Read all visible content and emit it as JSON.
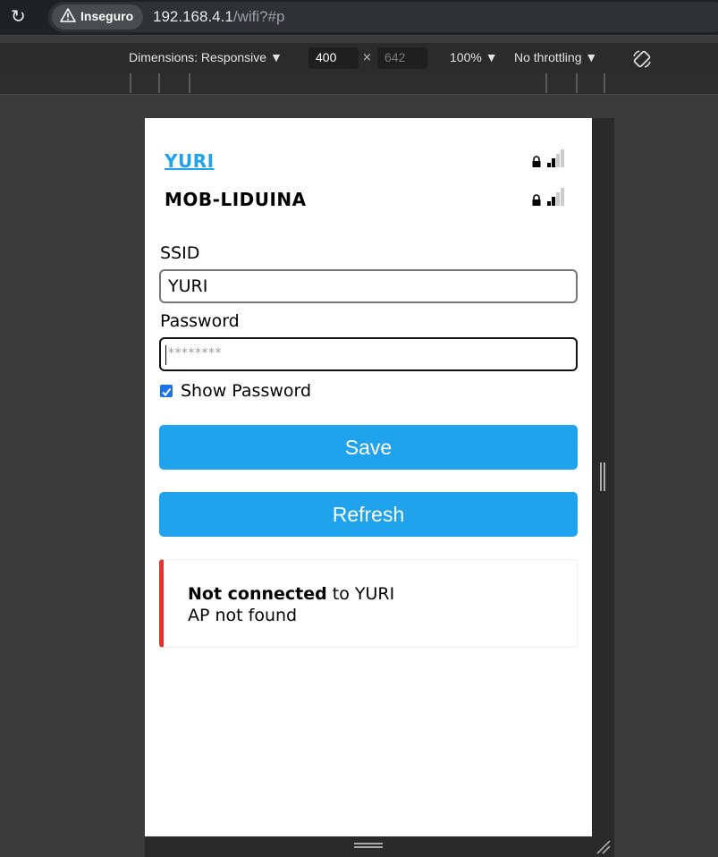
{
  "browser": {
    "security_label": "Inseguro",
    "url_host": "192.168.4.1",
    "url_path": "/wifi?#p"
  },
  "devtools": {
    "dimensions_label": "Dimensions: Responsive ▼",
    "width": "400",
    "height": "642",
    "zoom_label": "100% ▼",
    "throttling_label": "No throttling ▼"
  },
  "networks": [
    {
      "ssid": "YURI",
      "secured": true,
      "signal_bars": 2,
      "selected": true
    },
    {
      "ssid": "MOB-LIDUINA",
      "secured": true,
      "signal_bars": 2,
      "selected": false
    }
  ],
  "form": {
    "ssid_label": "SSID",
    "ssid_value": "YURI",
    "password_label": "Password",
    "password_placeholder": "********",
    "show_password_label": "Show Password",
    "show_password_checked": true
  },
  "buttons": {
    "save": "Save",
    "refresh": "Refresh"
  },
  "status": {
    "bold": "Not connected",
    "rest": " to YURI",
    "detail": "AP not found"
  },
  "colors": {
    "accent": "#1fa3ec",
    "error": "#dc3630"
  }
}
